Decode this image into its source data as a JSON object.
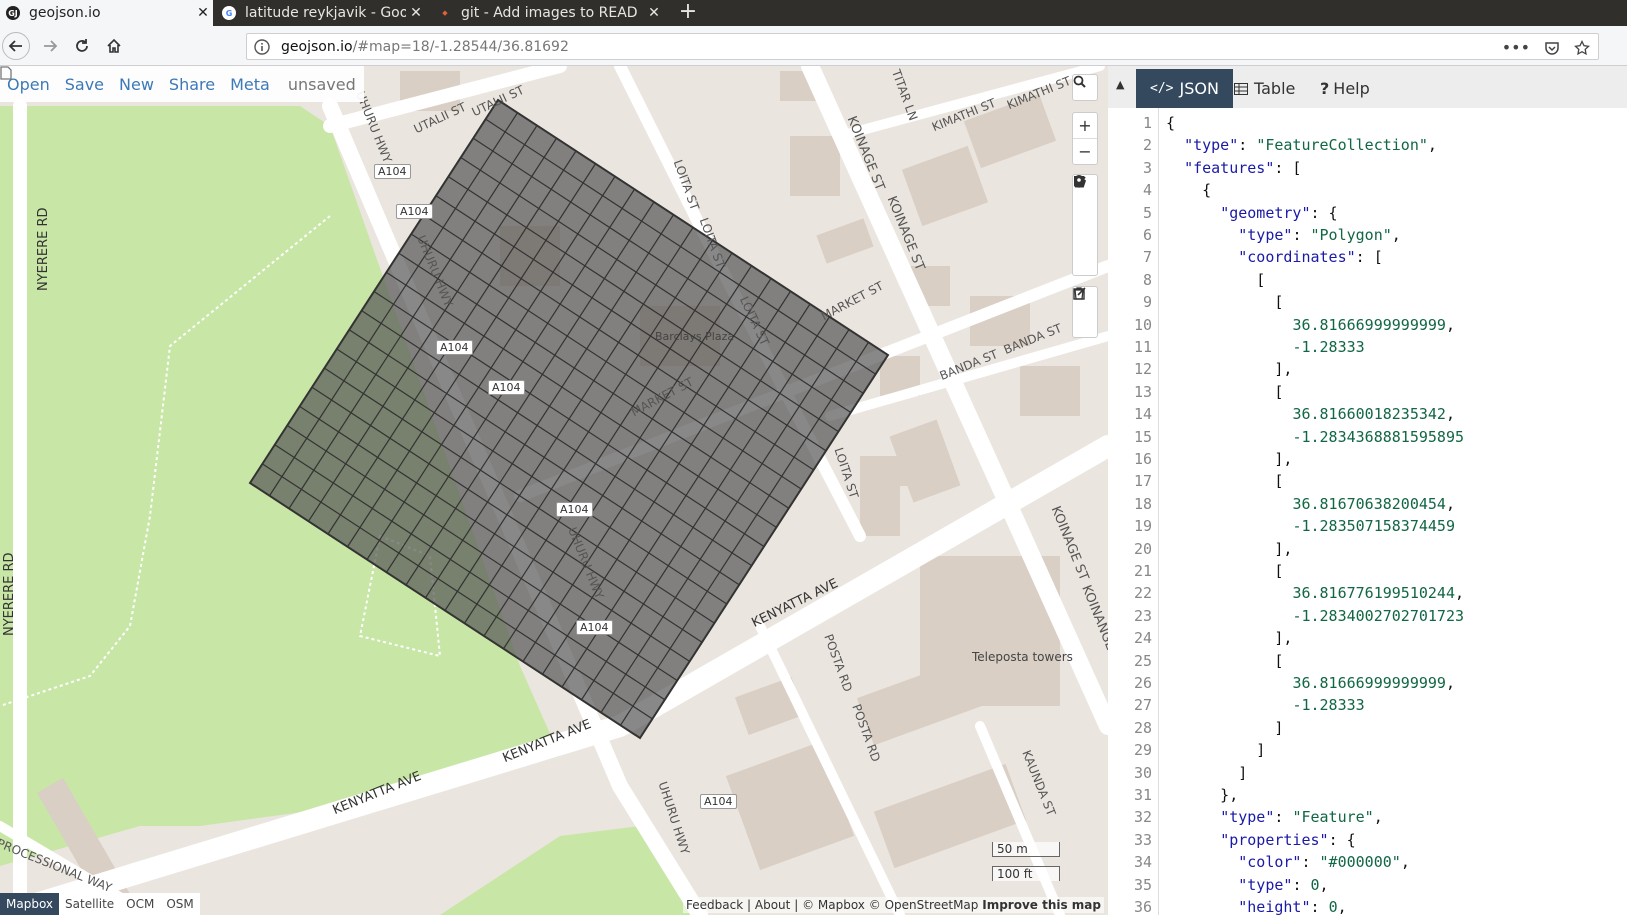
{
  "browser": {
    "tabs": [
      {
        "title": "geojson.io",
        "favicon": "GJ",
        "active": true
      },
      {
        "title": "latitude reykjavik - Goog",
        "favicon": "G",
        "active": false
      },
      {
        "title": "git - Add images to READ",
        "favicon": "git",
        "active": false
      }
    ],
    "url_host": "geojson.io",
    "url_rest": "/#map=18/-1.28544/36.81692"
  },
  "toolbar": {
    "open": "Open",
    "save": "Save",
    "new": "New",
    "share": "Share",
    "meta": "Meta",
    "status": "unsaved"
  },
  "map": {
    "labels": {
      "utalii": "UTALII ST",
      "utalii2": "UTALII ST",
      "uhuru1": "UHURU HWY",
      "uhuru2": "UHURU HWY",
      "uhuru3": "UHURU HWY",
      "uhuru4": "UHURU HWY",
      "loita1": "LOITA ST",
      "loita2": "LOITA ST",
      "loita3": "LOITA ST",
      "loita4": "LOITA ST",
      "koinange1": "KOINAGE ST",
      "koinange2": "KOINAGE ST",
      "koinange3": "KOINAGE ST",
      "koinange4": "KOINANGE S",
      "kimathi": "KIMATHI ST",
      "kimathi2": "KIMATHI ST",
      "titan": "TITAR LN",
      "market1": "MARKET ST",
      "market2": "MARKET ST",
      "banda1": "BANDA ST",
      "banda2": "BANDA ST",
      "kenyatta1": "KENYATTA AVE",
      "kenyatta2": "KENYATTA AVE",
      "kenyatta3": "KENYATTA AVE",
      "posta1": "POSTA RD",
      "posta2": "POSTA RD",
      "kaunda": "KAUNDA ST",
      "nyerere1": "NYERERE RD",
      "nyerere2": "NYERERE RD",
      "processional": "PROCESSIONAL WAY",
      "barclays": "Barclays Plaza",
      "teleposta": "Teleposta towers"
    },
    "shields": [
      "A104",
      "A104",
      "A104",
      "A104",
      "A104",
      "A104",
      "A104"
    ],
    "scale_metric": "50 m",
    "scale_imperial": "100 ft",
    "layers": [
      "Mapbox",
      "Satellite",
      "OCM",
      "OSM"
    ],
    "active_layer": "Mapbox",
    "attribution": {
      "feedback": "Feedback",
      "about": "About",
      "mapbox": "© Mapbox",
      "osm": "© OpenStreetMap",
      "improve": "Improve this map",
      "sep": "|"
    }
  },
  "panel": {
    "tabs": [
      {
        "label": "JSON",
        "icon": "code-icon",
        "active": true
      },
      {
        "label": "Table",
        "icon": "table-icon",
        "active": false
      },
      {
        "label": "Help",
        "icon": "question-icon",
        "active": false
      }
    ],
    "code_lines": [
      "{",
      "  \"type\": \"FeatureCollection\",",
      "  \"features\": [",
      "    {",
      "      \"geometry\": {",
      "        \"type\": \"Polygon\",",
      "        \"coordinates\": [",
      "          [",
      "            [",
      "              36.81666999999999,",
      "              -1.28333",
      "            ],",
      "            [",
      "              36.81660018235342,",
      "              -1.2834368881595895",
      "            ],",
      "            [",
      "              36.81670638200454,",
      "              -1.283507158374459",
      "            ],",
      "            [",
      "              36.816776199510244,",
      "              -1.2834002702701723",
      "            ],",
      "            [",
      "              36.81666999999999,",
      "              -1.28333",
      "            ]",
      "          ]",
      "        ]",
      "      },",
      "      \"type\": \"Feature\",",
      "      \"properties\": {",
      "        \"color\": \"#000000\",",
      "        \"type\": 0,",
      "        \"height\": 0,"
    ]
  },
  "colors": {
    "accent": "#34495e",
    "link": "#3c79b8",
    "park": "#c8e6a5",
    "building": "#d9cfc4",
    "polygon_fill": "#555555"
  }
}
